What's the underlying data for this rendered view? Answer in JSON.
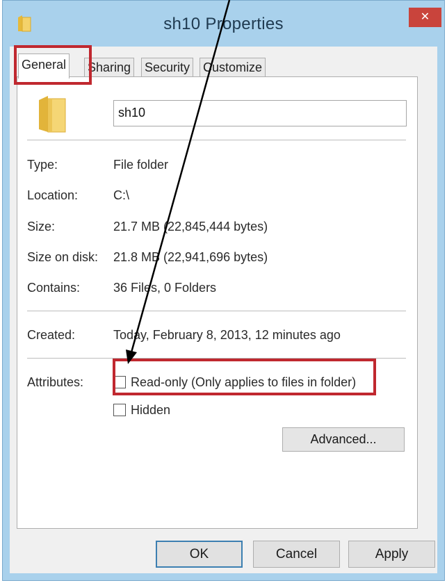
{
  "window": {
    "title": "sh10 Properties",
    "close_glyph": "✕"
  },
  "tabs": [
    {
      "label": "General",
      "active": true
    },
    {
      "label": "Sharing",
      "active": false
    },
    {
      "label": "Security",
      "active": false
    },
    {
      "label": "Customize",
      "active": false
    }
  ],
  "general": {
    "name_value": "sh10",
    "type_label": "Type:",
    "type_value": "File folder",
    "location_label": "Location:",
    "location_value": "C:\\",
    "size_label": "Size:",
    "size_value": "21.7 MB (22,845,444 bytes)",
    "size_on_disk_label": "Size on disk:",
    "size_on_disk_value": "21.8 MB (22,941,696 bytes)",
    "contains_label": "Contains:",
    "contains_value": "36 Files, 0 Folders",
    "created_label": "Created:",
    "created_value": "Today, February 8, 2013, 12 minutes ago",
    "attributes_label": "Attributes:",
    "readonly_label": "Read-only (Only applies to files in folder)",
    "readonly_checked": false,
    "hidden_label": "Hidden",
    "hidden_checked": false,
    "advanced_label": "Advanced..."
  },
  "buttons": {
    "ok": "OK",
    "cancel": "Cancel",
    "apply": "Apply"
  },
  "colors": {
    "frame": "#a9d1ec",
    "close": "#c9443c",
    "highlight": "#c0282f",
    "folder": "#f3cf5a"
  },
  "icons": {
    "title": "folder-icon",
    "close": "close-icon",
    "folder": "folder-icon"
  }
}
